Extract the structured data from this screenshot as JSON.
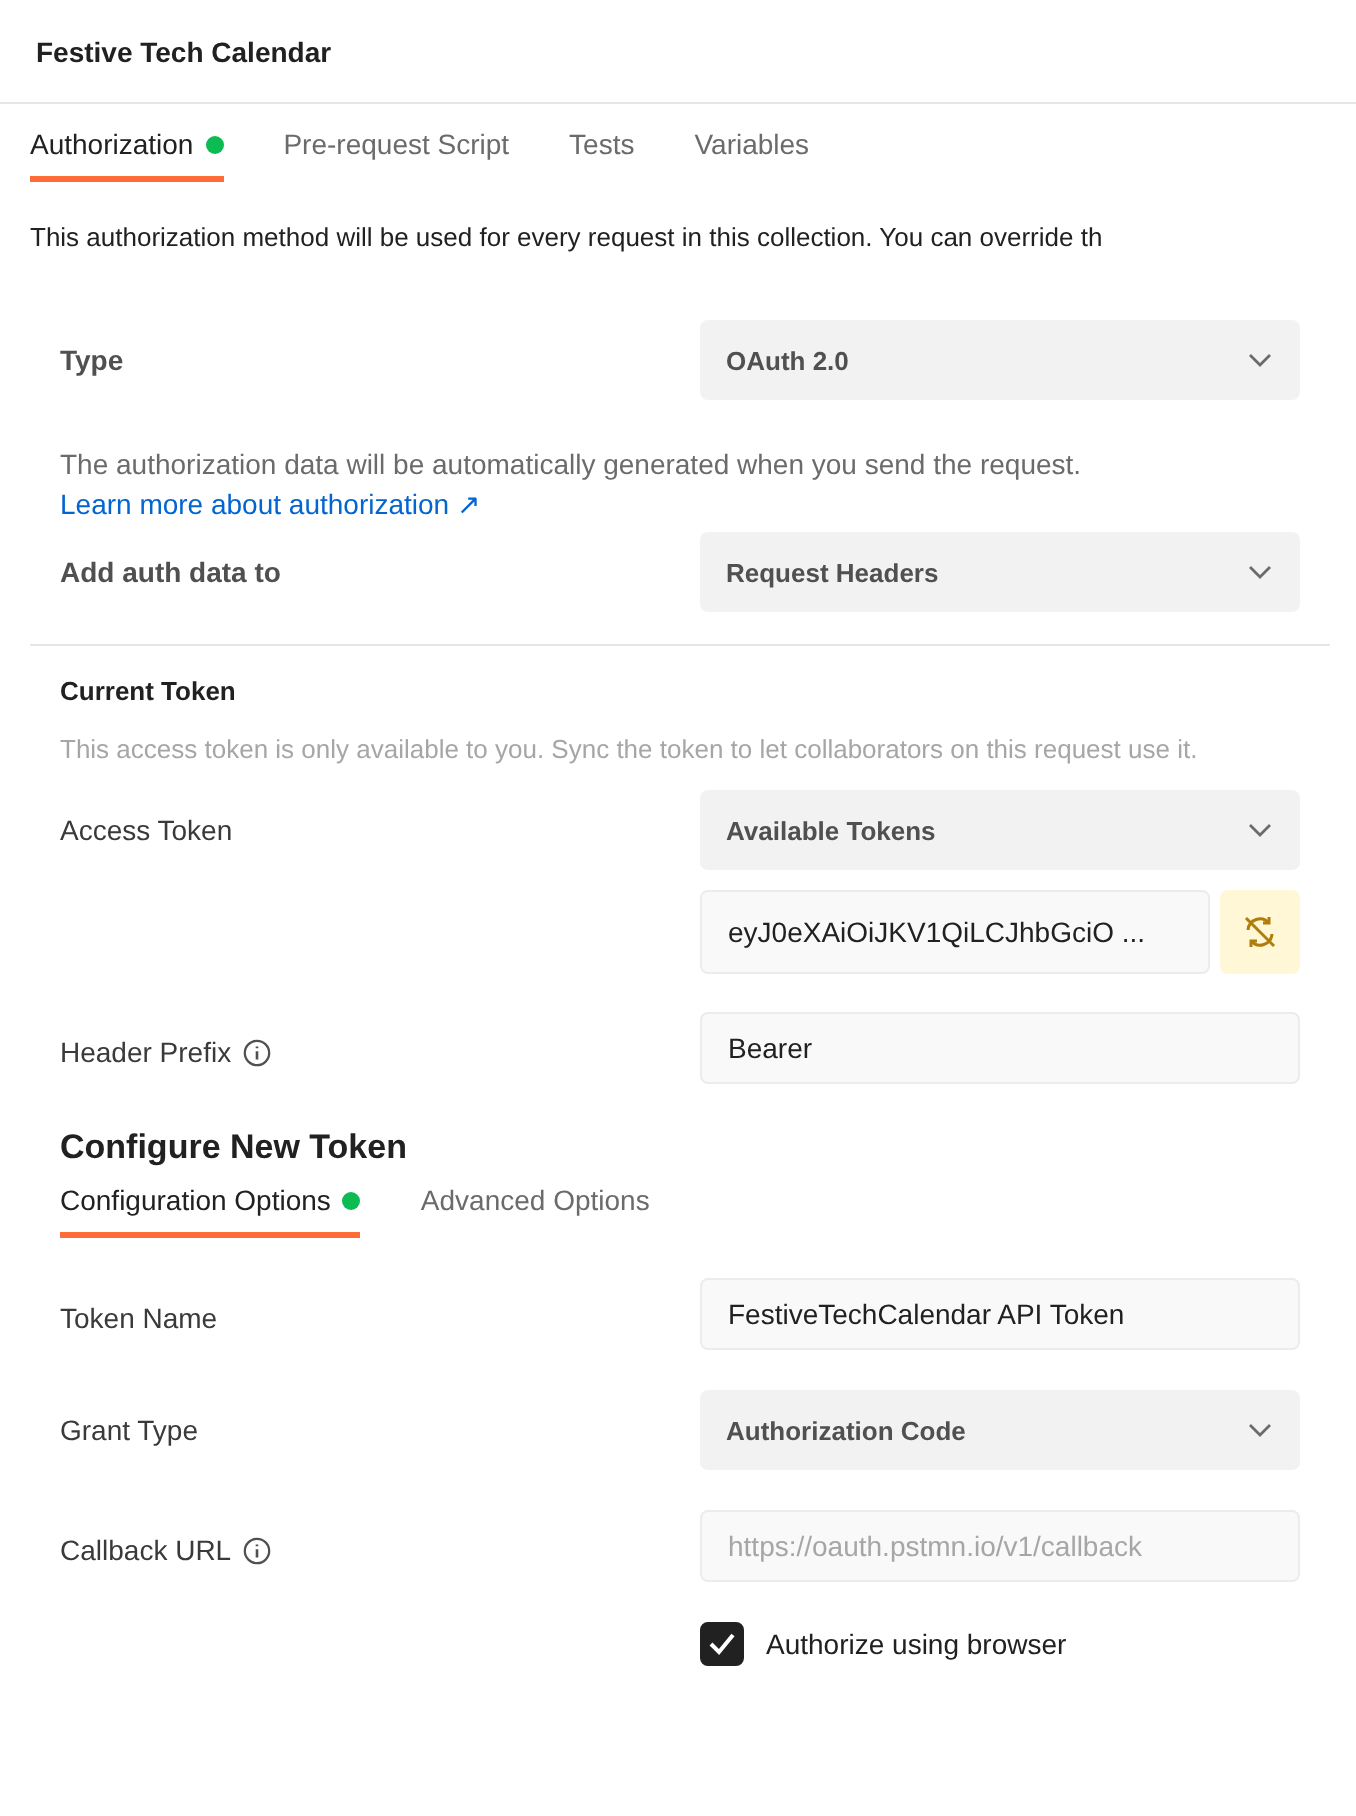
{
  "title": "Festive Tech Calendar",
  "tabs": [
    {
      "label": "Authorization",
      "selected": true,
      "dot": true
    },
    {
      "label": "Pre-request Script",
      "selected": false,
      "dot": false
    },
    {
      "label": "Tests",
      "selected": false,
      "dot": false
    },
    {
      "label": "Variables",
      "selected": false,
      "dot": false
    }
  ],
  "intro": "This authorization method will be used for every request in this collection. You can override th",
  "type": {
    "label": "Type",
    "kind": "select",
    "value": "OAuth 2.0"
  },
  "note": {
    "text": "The authorization data will be automatically generated when you send the request.",
    "link": "Learn more about authorization ↗"
  },
  "add_auth": {
    "label": "Add auth data to",
    "kind": "select",
    "value": "Request Headers"
  },
  "current_token": {
    "heading": "Current Token",
    "note": "This access token is only available to you. Sync the token to let collaborators on this request use it."
  },
  "access_token": {
    "label": "Access Token",
    "dropdown": "Available Tokens",
    "value": "eyJ0eXAiOiJKV1QiLCJhbGciO ..."
  },
  "header_prefix": {
    "label": "Header Prefix",
    "info": true,
    "kind": "input",
    "value": "Bearer"
  },
  "configure": {
    "heading": "Configure New Token",
    "tabs": [
      {
        "label": "Configuration Options",
        "selected": true,
        "dot": true
      },
      {
        "label": "Advanced Options",
        "selected": false,
        "dot": false
      }
    ],
    "fields": [
      {
        "label": "Token Name",
        "info": false,
        "kind": "input",
        "value": "FestiveTechCalendar API Token"
      },
      {
        "label": "Grant Type",
        "info": false,
        "kind": "select",
        "value": "Authorization Code"
      },
      {
        "label": "Callback URL",
        "info": true,
        "kind": "input",
        "placeholder": "https://oauth.pstmn.io/v1/callback"
      }
    ],
    "authorize_browser": {
      "label": "Authorize using browser",
      "checked": true
    }
  }
}
